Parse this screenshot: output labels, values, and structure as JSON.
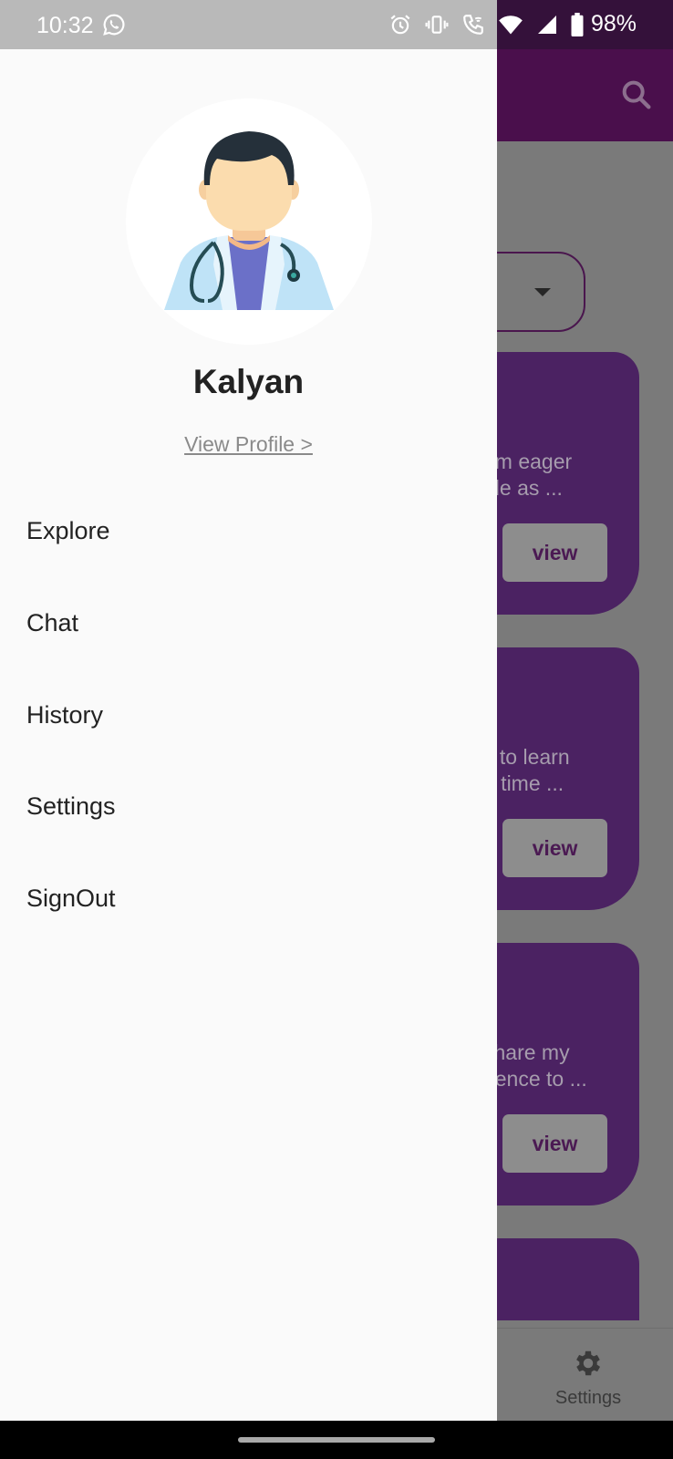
{
  "status_bar": {
    "time": "10:32",
    "battery": "98%",
    "icons": [
      "whatsapp-icon",
      "alarm-icon",
      "vibrate-icon",
      "wifi-calling-icon",
      "wifi-icon",
      "signal-icon",
      "battery-icon"
    ]
  },
  "drawer": {
    "user_name": "Kalyan",
    "view_profile": "View Profile >",
    "menu": [
      "Explore",
      "Chat",
      "History",
      "Settings",
      "SignOut"
    ]
  },
  "background": {
    "cards": [
      {
        "desc": "am eager\nble as ...",
        "button": "view"
      },
      {
        "desc": "c to learn\ne time ...",
        "button": "view"
      },
      {
        "desc": "share my\nrience to ...",
        "button": "view"
      },
      {
        "desc": "",
        "button": ""
      }
    ],
    "bottom_nav_settings": "Settings"
  },
  "colors": {
    "app_bar": "#4a0f4c",
    "card": "#4b2262",
    "drawer_bg": "#fafafa"
  }
}
